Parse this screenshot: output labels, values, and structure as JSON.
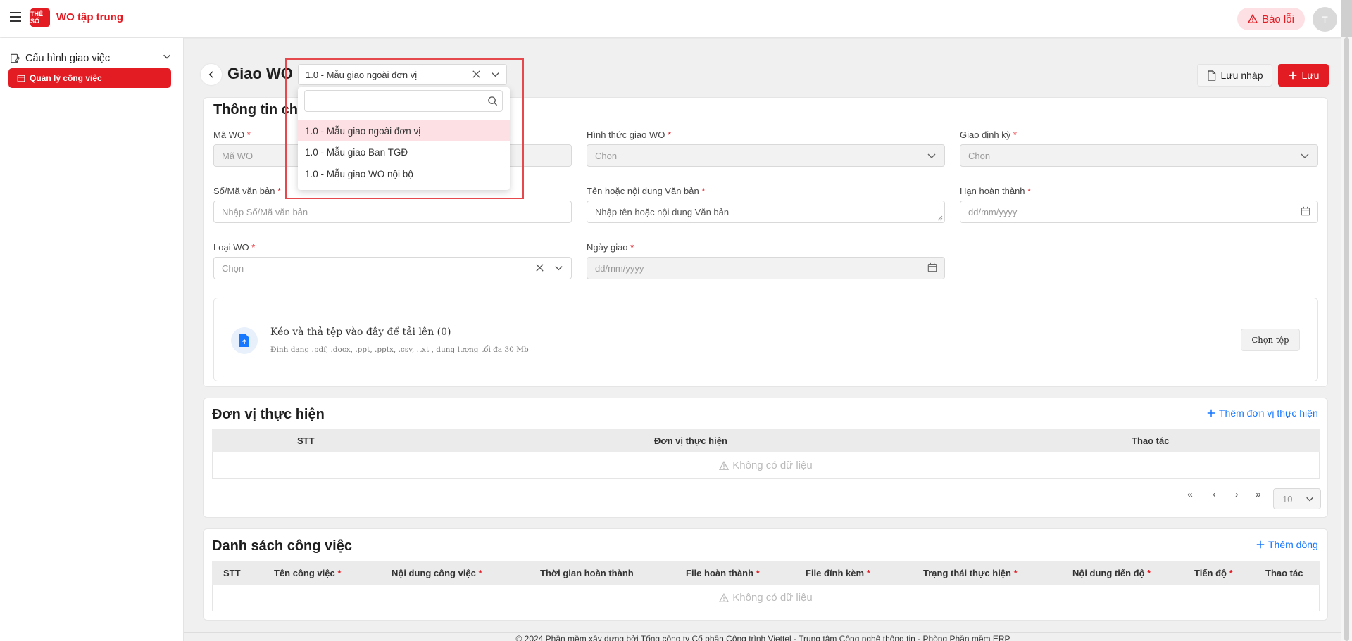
{
  "app": {
    "title": "WO tập trung",
    "logo_text": "THẺ SỐ",
    "report_label": "Báo lỗi",
    "avatar_letter": "T"
  },
  "sidebar": {
    "parent_label": "Cấu hình giao việc",
    "child_label": "Quản lý công việc"
  },
  "header": {
    "title": "Giao WO",
    "template_value": "1.0 - Mẫu giao ngoài đơn vị",
    "draft_label": "Lưu nháp",
    "save_label": "Lưu"
  },
  "dropdown": {
    "search_placeholder": "",
    "options": [
      {
        "label": "1.0 - Mẫu giao ngoài đơn vị",
        "selected": true
      },
      {
        "label": "1.0 - Mẫu giao Ban TGĐ",
        "selected": false
      },
      {
        "label": "1.0 - Mẫu giao WO nội bộ",
        "selected": false
      }
    ]
  },
  "info": {
    "title": "Thông tin ch",
    "wo_code": {
      "label": "Mã WO",
      "placeholder": "Mã WO"
    },
    "assign_form": {
      "label": "Hình thức giao WO",
      "placeholder": "Chọn"
    },
    "periodic": {
      "label": "Giao định kỳ",
      "placeholder": "Chọn"
    },
    "doc_number": {
      "label": "Số/Mã văn bản",
      "placeholder": "Nhập Số/Mã văn bản"
    },
    "doc_name": {
      "label": "Tên hoặc nội dung Văn bản",
      "placeholder": "Nhập tên hoặc nội dung Văn bản"
    },
    "deadline": {
      "label": "Hạn hoàn thành",
      "placeholder": "dd/mm/yyyy"
    },
    "wo_type": {
      "label": "Loại WO",
      "placeholder": "Chọn"
    },
    "assign_date": {
      "label": "Ngày giao",
      "placeholder": "dd/mm/yyyy"
    },
    "required_mark": "*"
  },
  "upload": {
    "title": "Kéo và thả tệp vào đây để tải lên (0)",
    "hint": "Định dạng .pdf, .docx, .ppt, .pptx, .csv, .txt , dung lượng tối đa 30 Mb",
    "button": "Chọn tệp"
  },
  "units": {
    "title": "Đơn vị thực hiện",
    "add_label": "Thêm đơn vị thực hiện",
    "columns": [
      "STT",
      "Đơn vị thực hiện",
      "Thao tác"
    ],
    "empty": "Không có dữ liệu",
    "pager": {
      "first": "«",
      "prev": "‹",
      "next": "›",
      "last": "»",
      "page_size": "10"
    }
  },
  "tasks": {
    "title": "Danh sách công việc",
    "add_label": "Thêm dòng",
    "columns": [
      "STT",
      "Tên công việc",
      "Nội dung công việc",
      "Thời gian hoàn thành",
      "File hoàn thành",
      "File đính kèm",
      "Trạng thái thực hiện",
      "Nội dung tiến độ",
      "Tiến độ",
      "Thao tác"
    ],
    "required": [
      false,
      true,
      true,
      false,
      true,
      true,
      true,
      true,
      true,
      false
    ],
    "empty": "Không có dữ liệu"
  },
  "footer": "© 2024 Phần mềm xây dựng bởi Tổng công ty Cổ phần Công trình Viettel - Trung tâm Công nghệ thông tin - Phòng Phần mềm ERP",
  "colors": {
    "brand": "#e31b23",
    "link": "#1677ff",
    "highlight": "#e5484d"
  }
}
